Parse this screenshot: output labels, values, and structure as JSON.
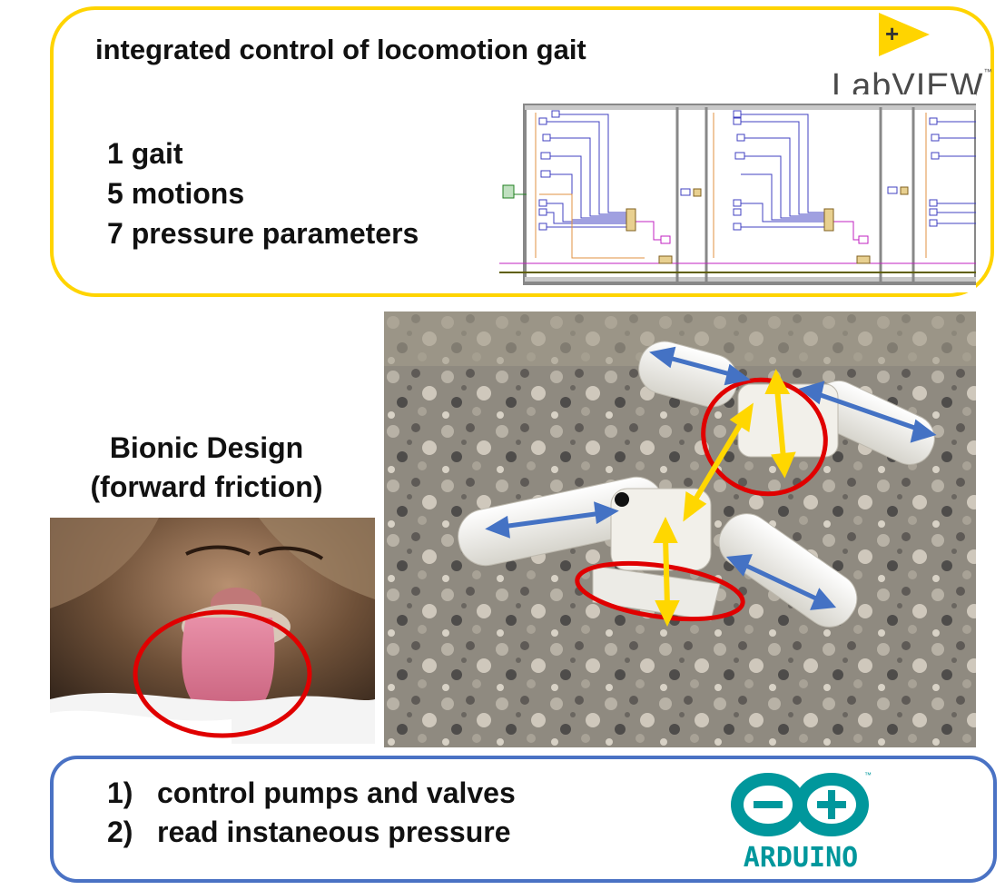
{
  "top_panel": {
    "title": "integrated control of locomotion gait",
    "items": [
      "1 gait",
      "5 motions",
      "7 pressure parameters"
    ],
    "logo_text": "LabVIEW",
    "logo_tm": "™",
    "logo_icon": "labview-plus-triangle",
    "border_color": "#ffd400"
  },
  "bionic": {
    "line1": "Bionic Design",
    "line2": "(forward friction)"
  },
  "bottom_panel": {
    "items": [
      {
        "num": "1)",
        "text": "control pumps and valves"
      },
      {
        "num": "2)",
        "text": "read instaneous pressure"
      }
    ],
    "logo_text": "ARDUINO",
    "logo_tm": "™",
    "border_color": "#4a72c4"
  },
  "colors": {
    "arrow_blue": "#4472c4",
    "arrow_yellow": "#ffd700",
    "highlight_red": "#e00000",
    "arduino_teal": "#00979c"
  }
}
